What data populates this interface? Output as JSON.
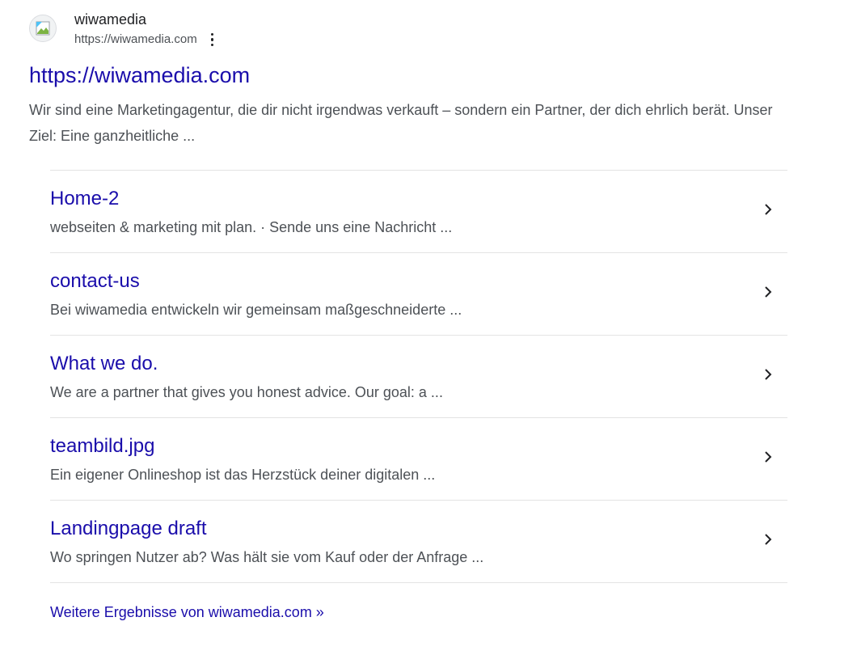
{
  "site": {
    "name": "wiwamedia",
    "url": "https://wiwamedia.com",
    "favicon_icon": "broken-image-icon",
    "menu_icon": "more-vert-icon"
  },
  "result": {
    "title": "https://wiwamedia.com",
    "snippet": "Wir sind eine Marketingagentur, die dir nicht irgendwas verkauft – sondern ein Partner, der dich ehrlich berät. Unser Ziel: Eine ganzheitliche ..."
  },
  "sitelinks": [
    {
      "title": "Home-2",
      "description": "webseiten & marketing mit plan. · Sende uns eine Nachricht ..."
    },
    {
      "title": "contact-us",
      "description": "Bei wiwamedia entwickeln wir gemeinsam maßgeschneiderte ..."
    },
    {
      "title": "What we do.",
      "description": "We are a partner that gives you honest advice. Our goal: a ..."
    },
    {
      "title": "teambild.jpg",
      "description": "Ein eigener Onlineshop ist das Herzstück deiner digitalen ..."
    },
    {
      "title": "Landingpage draft",
      "description": "Wo springen Nutzer ab? Was hält sie vom Kauf oder der Anfrage ..."
    }
  ],
  "more_results_label": "Weitere Ergebnisse von wiwamedia.com »",
  "colors": {
    "link": "#1a0dab",
    "text": "#202124",
    "muted": "#4d5156",
    "divider": "#e3e3e3"
  }
}
